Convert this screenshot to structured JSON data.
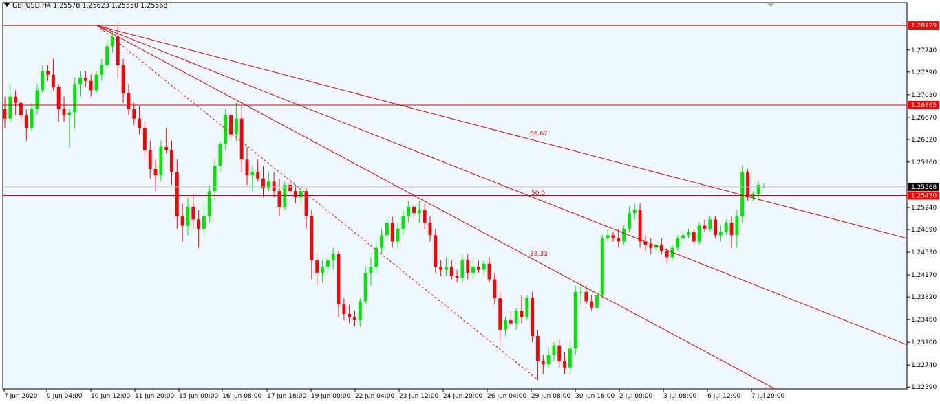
{
  "header": {
    "symbol": "GBPUSD,H4",
    "o": "1.25578",
    "h": "1.25623",
    "l": "1.25550",
    "c": "1.25568"
  },
  "colors": {
    "background": "#f0f8ff",
    "bull": "#00e600",
    "bear": "#ff0000",
    "line": "#e00000",
    "grid": "#000000"
  },
  "chart_data": {
    "type": "candlestick",
    "symbol": "GBPUSD",
    "timeframe": "H4",
    "ylim": [
      1.2236,
      1.2849
    ],
    "y_ticks": [
      "1.27740",
      "1.27390",
      "1.27030",
      "1.26670",
      "1.26320",
      "1.25960",
      "1.25240",
      "1.24890",
      "1.24530",
      "1.24170",
      "1.23820",
      "1.23460",
      "1.23100",
      "1.22740",
      "1.22390"
    ],
    "x_ticks": [
      "7 Jun 2020",
      "9 Jun 04:00",
      "10 Jun 12:00",
      "11 Jun 20:00",
      "15 Jun 00:00",
      "16 Jun 08:00",
      "17 Jun 16:00",
      "19 Jun 00:00",
      "22 Jun 04:00",
      "23 Jun 12:00",
      "24 Jun 20:00",
      "26 Jun 04:00",
      "29 Jun 08:00",
      "30 Jun 16:00",
      "2 Jul 00:00",
      "3 Jul 08:00",
      "6 Jul 12:00",
      "7 Jul 20:00"
    ],
    "price_levels": [
      {
        "value": 1.28129,
        "label": "1.28129",
        "style": "red-tag"
      },
      {
        "value": 1.26865,
        "label": "1.26865",
        "style": "red-tag"
      },
      {
        "value": 1.2543,
        "label": "1.25430",
        "style": "red-tag"
      },
      {
        "value": 1.25568,
        "label": "1.25568",
        "style": "black-tag"
      }
    ],
    "fan_labels": [
      "66.67",
      "50.0",
      "33.33"
    ],
    "candles": [
      [
        1.268,
        1.27,
        1.265,
        1.2665
      ],
      [
        1.2665,
        1.272,
        1.266,
        1.27
      ],
      [
        1.27,
        1.271,
        1.267,
        1.269
      ],
      [
        1.269,
        1.2695,
        1.266,
        1.267
      ],
      [
        1.267,
        1.268,
        1.263,
        1.265
      ],
      [
        1.265,
        1.269,
        1.2645,
        1.268
      ],
      [
        1.268,
        1.272,
        1.267,
        1.271
      ],
      [
        1.271,
        1.275,
        1.2705,
        1.274
      ],
      [
        1.274,
        1.275,
        1.2725,
        1.2735
      ],
      [
        1.2735,
        1.276,
        1.271,
        1.2715
      ],
      [
        1.2715,
        1.272,
        1.266,
        1.268
      ],
      [
        1.268,
        1.27,
        1.266,
        1.267
      ],
      [
        1.267,
        1.268,
        1.262,
        1.2675
      ],
      [
        1.2675,
        1.273,
        1.265,
        1.272
      ],
      [
        1.272,
        1.274,
        1.27,
        1.273
      ],
      [
        1.273,
        1.274,
        1.2715,
        1.2725
      ],
      [
        1.2725,
        1.2735,
        1.27,
        1.271
      ],
      [
        1.271,
        1.274,
        1.2705,
        1.2735
      ],
      [
        1.2735,
        1.276,
        1.2725,
        1.275
      ],
      [
        1.275,
        1.279,
        1.2745,
        1.278
      ],
      [
        1.278,
        1.2805,
        1.277,
        1.2795
      ],
      [
        1.2795,
        1.2812,
        1.273,
        1.275
      ],
      [
        1.275,
        1.276,
        1.269,
        1.2705
      ],
      [
        1.2705,
        1.272,
        1.267,
        1.268
      ],
      [
        1.268,
        1.269,
        1.2655,
        1.2665
      ],
      [
        1.2665,
        1.2685,
        1.264,
        1.265
      ],
      [
        1.265,
        1.266,
        1.26,
        1.2615
      ],
      [
        1.2615,
        1.263,
        1.257,
        1.2585
      ],
      [
        1.2585,
        1.26,
        1.255,
        1.2575
      ],
      [
        1.2575,
        1.263,
        1.2565,
        1.262
      ],
      [
        1.262,
        1.265,
        1.261,
        1.2615
      ],
      [
        1.2615,
        1.263,
        1.256,
        1.258
      ],
      [
        1.258,
        1.26,
        1.249,
        1.251
      ],
      [
        1.251,
        1.253,
        1.247,
        1.2495
      ],
      [
        1.2495,
        1.254,
        1.248,
        1.2525
      ],
      [
        1.2525,
        1.2545,
        1.249,
        1.2505
      ],
      [
        1.2505,
        1.252,
        1.246,
        1.249
      ],
      [
        1.249,
        1.253,
        1.248,
        1.251
      ],
      [
        1.251,
        1.256,
        1.25,
        1.255
      ],
      [
        1.255,
        1.26,
        1.2535,
        1.259
      ],
      [
        1.259,
        1.263,
        1.258,
        1.2625
      ],
      [
        1.2625,
        1.268,
        1.2615,
        1.267
      ],
      [
        1.267,
        1.2675,
        1.263,
        1.264
      ],
      [
        1.264,
        1.269,
        1.263,
        1.2665
      ],
      [
        1.2665,
        1.2685,
        1.258,
        1.26
      ],
      [
        1.26,
        1.262,
        1.256,
        1.2575
      ],
      [
        1.2575,
        1.259,
        1.255,
        1.258
      ],
      [
        1.258,
        1.26,
        1.2565,
        1.257
      ],
      [
        1.257,
        1.259,
        1.254,
        1.2555
      ],
      [
        1.2555,
        1.258,
        1.255,
        1.2565
      ],
      [
        1.2565,
        1.258,
        1.254,
        1.255
      ],
      [
        1.255,
        1.257,
        1.251,
        1.2525
      ],
      [
        1.2525,
        1.2565,
        1.252,
        1.256
      ],
      [
        1.256,
        1.257,
        1.2545,
        1.255
      ],
      [
        1.255,
        1.256,
        1.253,
        1.254
      ],
      [
        1.254,
        1.2555,
        1.253,
        1.255
      ],
      [
        1.255,
        1.2555,
        1.249,
        1.251
      ],
      [
        1.251,
        1.252,
        1.241,
        1.244
      ],
      [
        1.244,
        1.245,
        1.24,
        1.242
      ],
      [
        1.242,
        1.244,
        1.2405,
        1.243
      ],
      [
        1.243,
        1.2445,
        1.242,
        1.244
      ],
      [
        1.244,
        1.246,
        1.2425,
        1.245
      ],
      [
        1.245,
        1.2455,
        1.235,
        1.237
      ],
      [
        1.237,
        1.238,
        1.2345,
        1.2355
      ],
      [
        1.2355,
        1.237,
        1.234,
        1.235
      ],
      [
        1.235,
        1.236,
        1.2335,
        1.2345
      ],
      [
        1.2345,
        1.238,
        1.2335,
        1.2375
      ],
      [
        1.2375,
        1.243,
        1.237,
        1.242
      ],
      [
        1.242,
        1.2445,
        1.24,
        1.243
      ],
      [
        1.243,
        1.247,
        1.242,
        1.246
      ],
      [
        1.246,
        1.249,
        1.245,
        1.248
      ],
      [
        1.248,
        1.2505,
        1.247,
        1.25
      ],
      [
        1.25,
        1.251,
        1.246,
        1.247
      ],
      [
        1.247,
        1.25,
        1.246,
        1.249
      ],
      [
        1.249,
        1.252,
        1.248,
        1.251
      ],
      [
        1.251,
        1.2535,
        1.25,
        1.2525
      ],
      [
        1.2525,
        1.253,
        1.2505,
        1.2515
      ],
      [
        1.2515,
        1.2535,
        1.25,
        1.252
      ],
      [
        1.252,
        1.253,
        1.249,
        1.25
      ],
      [
        1.25,
        1.251,
        1.247,
        1.248
      ],
      [
        1.248,
        1.249,
        1.242,
        1.243
      ],
      [
        1.243,
        1.244,
        1.2415,
        1.2425
      ],
      [
        1.2425,
        1.2445,
        1.2415,
        1.243
      ],
      [
        1.243,
        1.244,
        1.241,
        1.2415
      ],
      [
        1.2415,
        1.2425,
        1.2405,
        1.2412
      ],
      [
        1.2412,
        1.245,
        1.2405,
        1.244
      ],
      [
        1.244,
        1.245,
        1.241,
        1.242
      ],
      [
        1.242,
        1.244,
        1.241,
        1.243
      ],
      [
        1.243,
        1.244,
        1.242,
        1.2425
      ],
      [
        1.2425,
        1.244,
        1.2415,
        1.2435
      ],
      [
        1.2435,
        1.2445,
        1.2405,
        1.241
      ],
      [
        1.241,
        1.242,
        1.237,
        1.238
      ],
      [
        1.238,
        1.239,
        1.231,
        1.233
      ],
      [
        1.233,
        1.235,
        1.232,
        1.2345
      ],
      [
        1.2345,
        1.236,
        1.2335,
        1.234
      ],
      [
        1.234,
        1.2365,
        1.233,
        1.236
      ],
      [
        1.236,
        1.2385,
        1.234,
        1.235
      ],
      [
        1.235,
        1.2385,
        1.2345,
        1.238
      ],
      [
        1.238,
        1.239,
        1.231,
        1.232
      ],
      [
        1.232,
        1.233,
        1.225,
        1.228
      ],
      [
        1.228,
        1.229,
        1.226,
        1.2275
      ],
      [
        1.2275,
        1.23,
        1.227,
        1.229
      ],
      [
        1.229,
        1.231,
        1.228,
        1.2305
      ],
      [
        1.2305,
        1.2315,
        1.227,
        1.228
      ],
      [
        1.228,
        1.2295,
        1.226,
        1.227
      ],
      [
        1.227,
        1.231,
        1.226,
        1.23
      ],
      [
        1.23,
        1.24,
        1.229,
        1.239
      ],
      [
        1.239,
        1.2405,
        1.237,
        1.239
      ],
      [
        1.239,
        1.24,
        1.237,
        1.2375
      ],
      [
        1.2375,
        1.2385,
        1.236,
        1.2365
      ],
      [
        1.2365,
        1.239,
        1.236,
        1.2385
      ],
      [
        1.2385,
        1.248,
        1.238,
        1.2475
      ],
      [
        1.2475,
        1.249,
        1.247,
        1.248
      ],
      [
        1.248,
        1.2485,
        1.247,
        1.2475
      ],
      [
        1.2475,
        1.249,
        1.246,
        1.247
      ],
      [
        1.247,
        1.2495,
        1.2465,
        1.249
      ],
      [
        1.249,
        1.2525,
        1.2485,
        1.2515
      ],
      [
        1.2515,
        1.253,
        1.2505,
        1.252
      ],
      [
        1.252,
        1.253,
        1.246,
        1.247
      ],
      [
        1.247,
        1.248,
        1.2455,
        1.2465
      ],
      [
        1.2465,
        1.2475,
        1.245,
        1.246
      ],
      [
        1.246,
        1.247,
        1.2455,
        1.2465
      ],
      [
        1.2465,
        1.2475,
        1.245,
        1.2455
      ],
      [
        1.2455,
        1.246,
        1.2435,
        1.2445
      ],
      [
        1.2445,
        1.2465,
        1.244,
        1.246
      ],
      [
        1.246,
        1.248,
        1.2455,
        1.2475
      ],
      [
        1.2475,
        1.2485,
        1.247,
        1.248
      ],
      [
        1.248,
        1.249,
        1.2475,
        1.2485
      ],
      [
        1.2485,
        1.249,
        1.2465,
        1.247
      ],
      [
        1.247,
        1.25,
        1.2465,
        1.2495
      ],
      [
        1.2495,
        1.2505,
        1.2485,
        1.249
      ],
      [
        1.249,
        1.251,
        1.2485,
        1.2505
      ],
      [
        1.2505,
        1.251,
        1.2475,
        1.248
      ],
      [
        1.248,
        1.2495,
        1.247,
        1.2485
      ],
      [
        1.2485,
        1.2505,
        1.248,
        1.25
      ],
      [
        1.25,
        1.251,
        1.246,
        1.248
      ],
      [
        1.248,
        1.252,
        1.246,
        1.251
      ],
      [
        1.251,
        1.259,
        1.25,
        1.258
      ],
      [
        1.258,
        1.2585,
        1.2535,
        1.254
      ],
      [
        1.254,
        1.255,
        1.2535,
        1.2545
      ],
      [
        1.2545,
        1.2565,
        1.2535,
        1.256
      ],
      [
        1.2556,
        1.2562,
        1.2555,
        1.2557
      ]
    ]
  }
}
